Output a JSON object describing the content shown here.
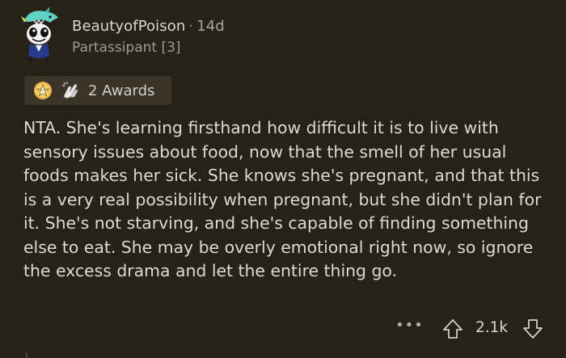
{
  "comment": {
    "author": "BeautyofPoison",
    "separator": "·",
    "age": "14d",
    "flair": "Partassipant [3]",
    "awards_label": "2 Awards",
    "body": "NTA. She's learning firsthand how difficult it is to live with sensory issues about food, now that the smell of her usual foods makes her sick. She knows she's pregnant, and that this is a very real possibility when pregnant, but she didn't plan for it. She's not starving, and she's capable of finding something else to eat. She may be overly emotional right now, so ignore the excess drama and let the entire thing go.",
    "more_label": "•••",
    "score": "2.1k"
  },
  "icons": {
    "avatar": "snoo-avatar-icon",
    "award_1": "star-award-icon",
    "award_2": "hands-award-icon",
    "upvote": "upvote-arrow-icon",
    "downvote": "downvote-arrow-icon"
  },
  "colors": {
    "background": "#262217",
    "text": "#dadad7",
    "muted": "#9b9b95",
    "awards_bg": "#3a3526"
  }
}
